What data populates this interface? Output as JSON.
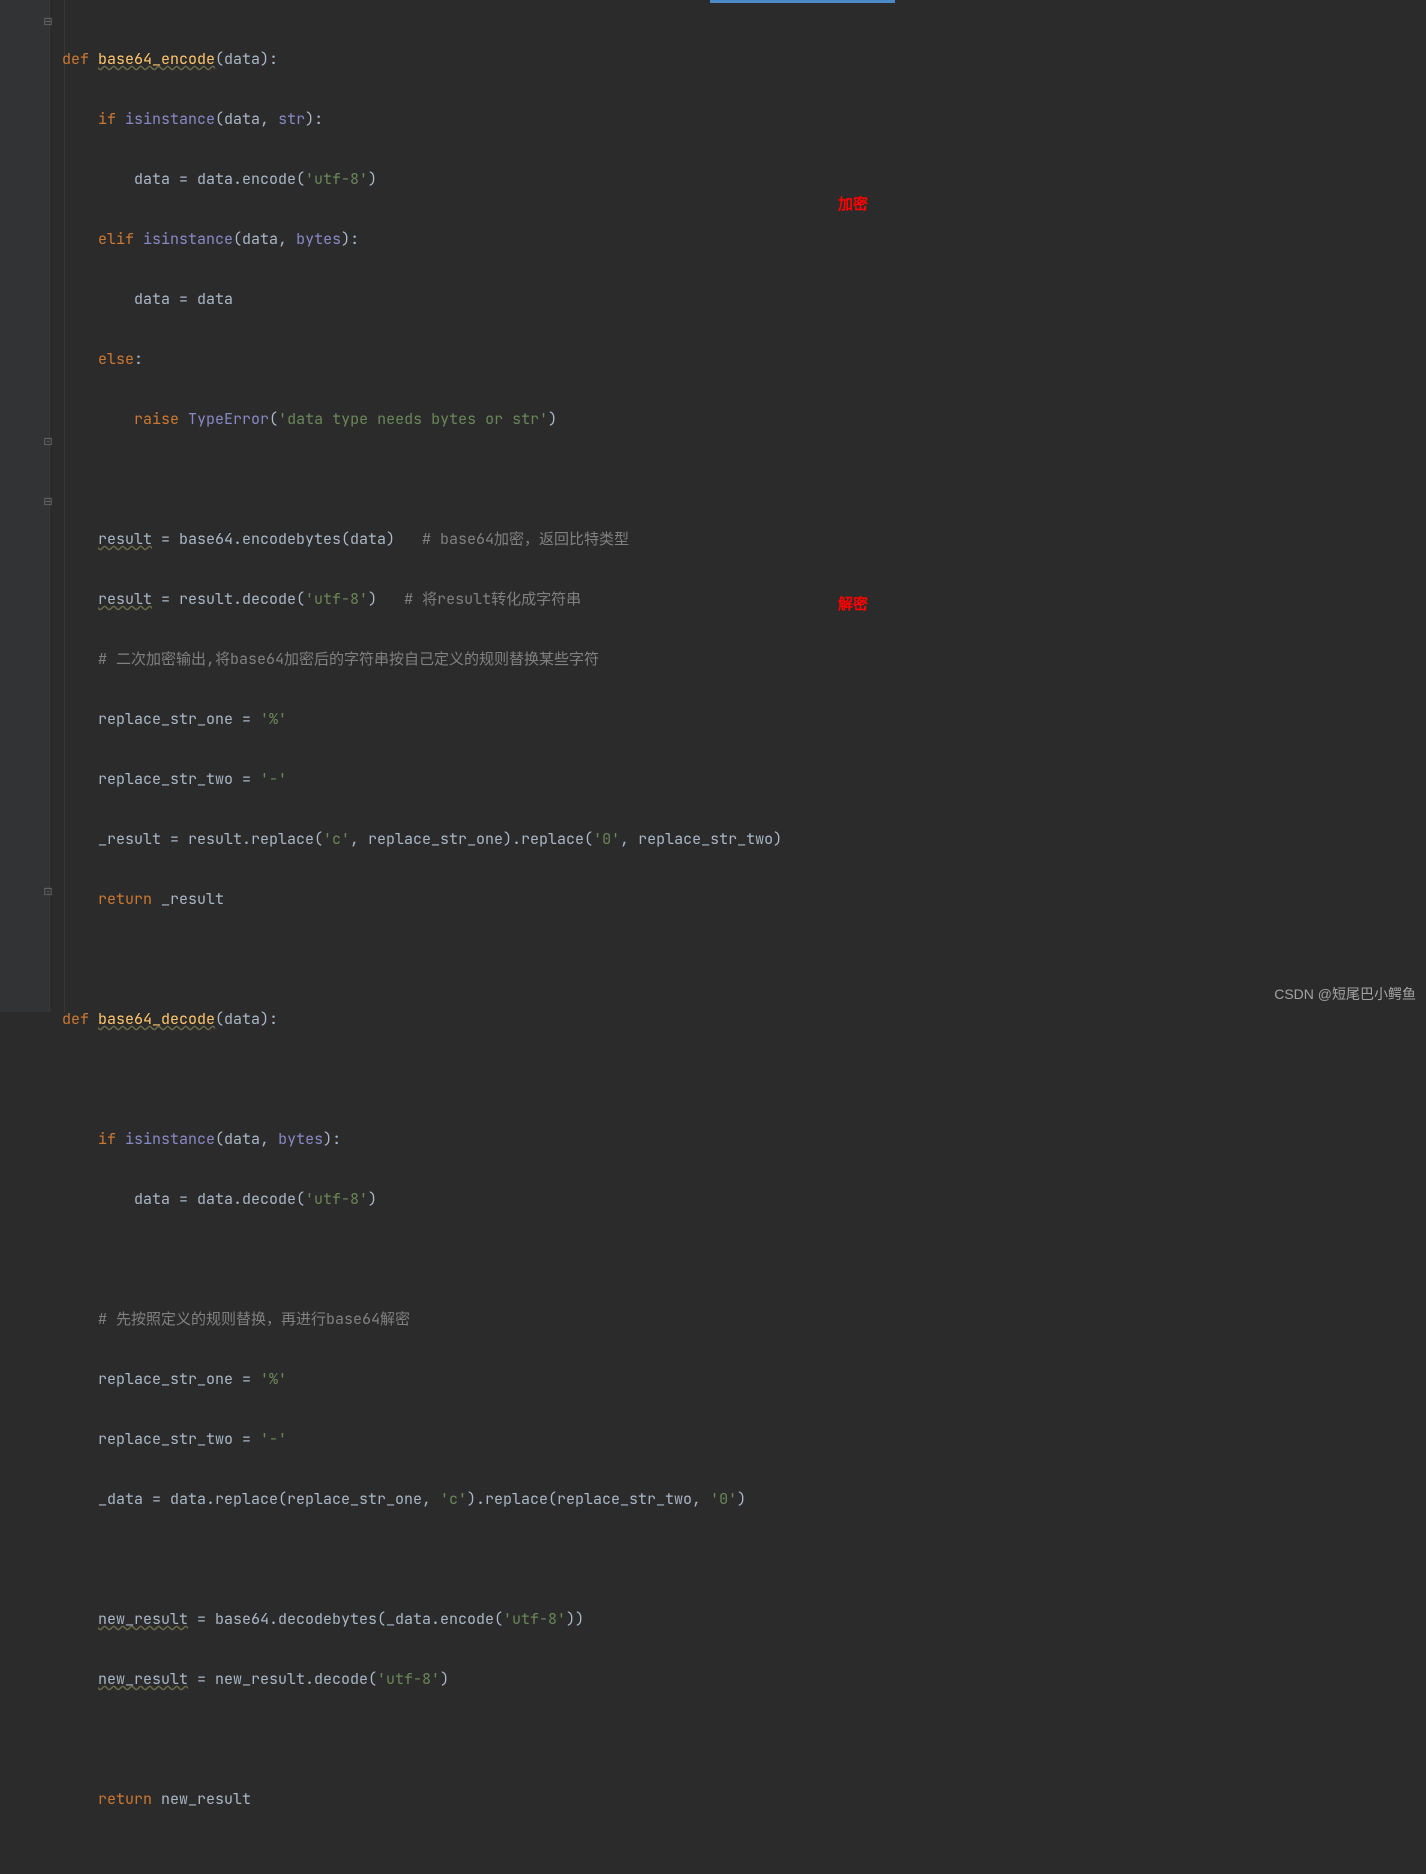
{
  "annotations": {
    "encrypt": "加密",
    "decrypt": "解密"
  },
  "watermark": "CSDN @短尾巴小鳄鱼",
  "code": {
    "l1": {
      "kw1": "def ",
      "fn": "base64_encode",
      "p": "(data):"
    },
    "l2": {
      "kw": "if ",
      "b": "isinstance",
      "args": "(data",
      "comma": ", ",
      "b2": "str",
      "close": "):"
    },
    "l3": {
      "lhs": "data = data.encode(",
      "s": "'utf-8'",
      "rhs": ")"
    },
    "l4": {
      "kw": "elif ",
      "b": "isinstance",
      "args": "(data",
      "comma": ", ",
      "b2": "bytes",
      "close": "):"
    },
    "l5": {
      "txt": "data = data"
    },
    "l6": {
      "kw": "else",
      "colon": ":"
    },
    "l7": {
      "kw": "raise ",
      "b": "TypeError",
      "open": "(",
      "s": "'data type needs bytes or str'",
      "close": ")"
    },
    "l8": {
      "txt": ""
    },
    "l9": {
      "v": "result",
      "eq": " = base64.encodebytes(data)   ",
      "c": "# base64加密，返回比特类型"
    },
    "l10": {
      "v": "result",
      "eq": " = result.decode(",
      "s": "'utf-8'",
      "close": ")   ",
      "c": "# 将result转化成字符串"
    },
    "l11": {
      "c": "# 二次加密输出,将base64加密后的字符串按自己定义的规则替换某些字符"
    },
    "l12": {
      "lhs": "replace_str_one = ",
      "s": "'%'"
    },
    "l13": {
      "lhs": "replace_str_two = ",
      "s": "'-'"
    },
    "l14": {
      "lhs": "_result = result.replace(",
      "s1": "'c'",
      "mid": ", replace_str_one).replace(",
      "s2": "'0'",
      "end": ", replace_str_two)"
    },
    "l15": {
      "kw": "return ",
      "v": "_result"
    },
    "l16": {
      "txt": ""
    },
    "l17": {
      "kw1": "def ",
      "fn": "base64_decode",
      "p": "(data):"
    },
    "l18": {
      "txt": ""
    },
    "l19": {
      "kw": "if ",
      "b": "isinstance",
      "args": "(data",
      "comma": ", ",
      "b2": "bytes",
      "close": "):"
    },
    "l20": {
      "lhs": "data = data.decode(",
      "s": "'utf-8'",
      "rhs": ")"
    },
    "l21": {
      "txt": ""
    },
    "l22": {
      "c": "# 先按照定义的规则替换，再进行base64解密"
    },
    "l23": {
      "lhs": "replace_str_one = ",
      "s": "'%'"
    },
    "l24": {
      "lhs": "replace_str_two = ",
      "s": "'-'"
    },
    "l25": {
      "lhs": "_data = data.replace(replace_str_one, ",
      "s1": "'c'",
      "mid": ").replace(replace_str_two, ",
      "s2": "'0'",
      "end": ")"
    },
    "l26": {
      "txt": ""
    },
    "l27": {
      "v": "new_result",
      "eq": " = base64.decodebytes(_data.encode(",
      "s": "'utf-8'",
      "close": "))"
    },
    "l28": {
      "v": "new_result",
      "eq": " = new_result.decode(",
      "s": "'utf-8'",
      "close": ")"
    },
    "l29": {
      "txt": ""
    },
    "l30": {
      "kw": "return ",
      "v": "new_result"
    }
  }
}
